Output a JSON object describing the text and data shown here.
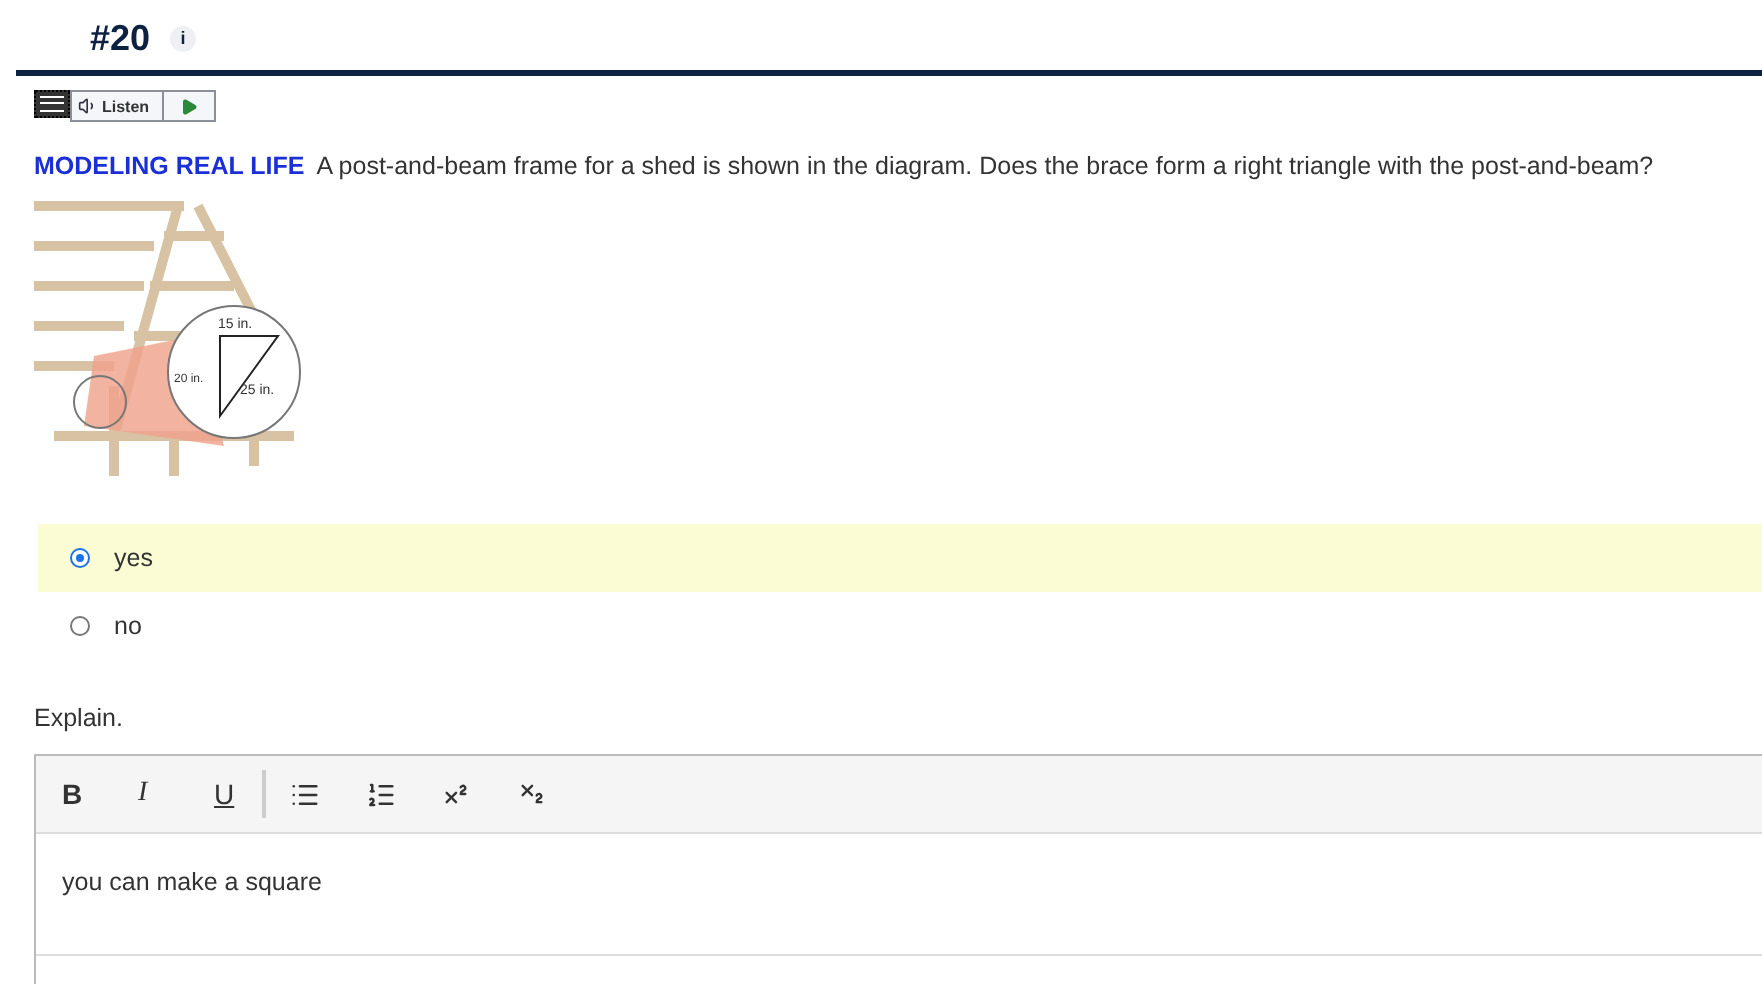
{
  "header": {
    "number": "#20",
    "info": "i"
  },
  "listen": {
    "label": "Listen"
  },
  "question": {
    "lead": "MODELING REAL LIFE",
    "text": "A post-and-beam frame for a shed is shown in the diagram. Does the brace form a right triangle with the post-and-beam?"
  },
  "diagram": {
    "labels": [
      "15 in.",
      "20 in.",
      "25 in."
    ]
  },
  "options": [
    {
      "label": "yes",
      "selected": true
    },
    {
      "label": "no",
      "selected": false
    }
  ],
  "explain": {
    "label": "Explain.",
    "toolbar": [
      {
        "kind": "bold",
        "label": "B"
      },
      {
        "kind": "italic",
        "label": "I"
      },
      {
        "kind": "underline",
        "label": "U"
      },
      {
        "kind": "divider"
      },
      {
        "kind": "bullets"
      },
      {
        "kind": "numbers"
      },
      {
        "kind": "superscript"
      },
      {
        "kind": "subscript"
      }
    ],
    "value": "you can make a square"
  }
}
